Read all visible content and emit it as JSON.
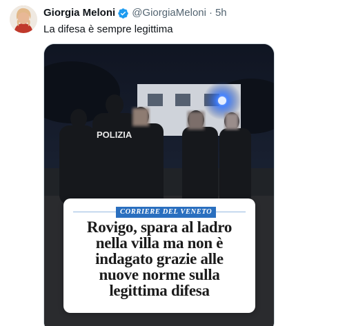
{
  "tweet": {
    "author": {
      "display_name": "Giorgia Meloni",
      "handle": "@GiorgiaMeloni",
      "verified_icon": "verified-badge-icon",
      "avatar_icon": "profile-avatar"
    },
    "separator": "·",
    "timestamp": "5h",
    "text": "La difesa è sempre legittima",
    "media": {
      "police_vest_text": "POLIZIA",
      "masthead": "CORRIERE DEL VENETO",
      "headline_lines": [
        "Rovigo, spara al ladro",
        "nella villa ma non è",
        "indagato grazie alle",
        "nuove norme sulla",
        "legittima difesa"
      ]
    }
  },
  "colors": {
    "text_primary": "#0f1419",
    "text_secondary": "#536471",
    "verified_blue": "#1d9bf0",
    "masthead_blue": "#2a6fbf",
    "police_light": "#3a7bff"
  }
}
